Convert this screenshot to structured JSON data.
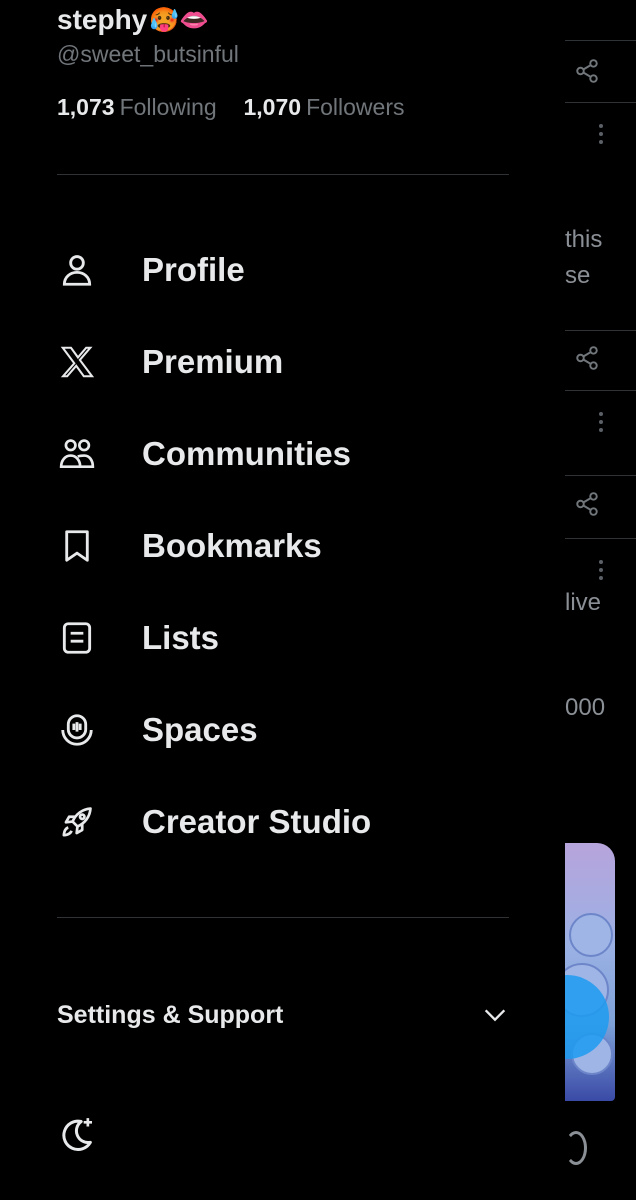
{
  "profile": {
    "display_name": "stephy",
    "name_emojis": "🥵👄",
    "handle": "@sweet_butsinful",
    "following_count": "1,073",
    "following_label": "Following",
    "followers_count": "1,070",
    "followers_label": "Followers"
  },
  "nav": {
    "items": [
      {
        "label": "Profile",
        "icon": "person-icon"
      },
      {
        "label": "Premium",
        "icon": "x-logo-icon"
      },
      {
        "label": "Communities",
        "icon": "communities-icon"
      },
      {
        "label": "Bookmarks",
        "icon": "bookmark-icon"
      },
      {
        "label": "Lists",
        "icon": "list-icon"
      },
      {
        "label": "Spaces",
        "icon": "spaces-icon"
      },
      {
        "label": "Creator Studio",
        "icon": "rocket-icon"
      }
    ]
  },
  "settings": {
    "label": "Settings & Support",
    "icon": "chevron-down-icon"
  },
  "footer": {
    "theme_icon": "moon-sparkle-icon"
  },
  "background_feed": {
    "snippet_1a": "this",
    "snippet_1b": "se",
    "snippet_2": "live",
    "snippet_3": "000"
  },
  "colors": {
    "background": "#000000",
    "text_primary": "#e7e9ea",
    "text_secondary": "#71767b",
    "divider": "#2f3336",
    "accent": "#1d9bf0"
  }
}
